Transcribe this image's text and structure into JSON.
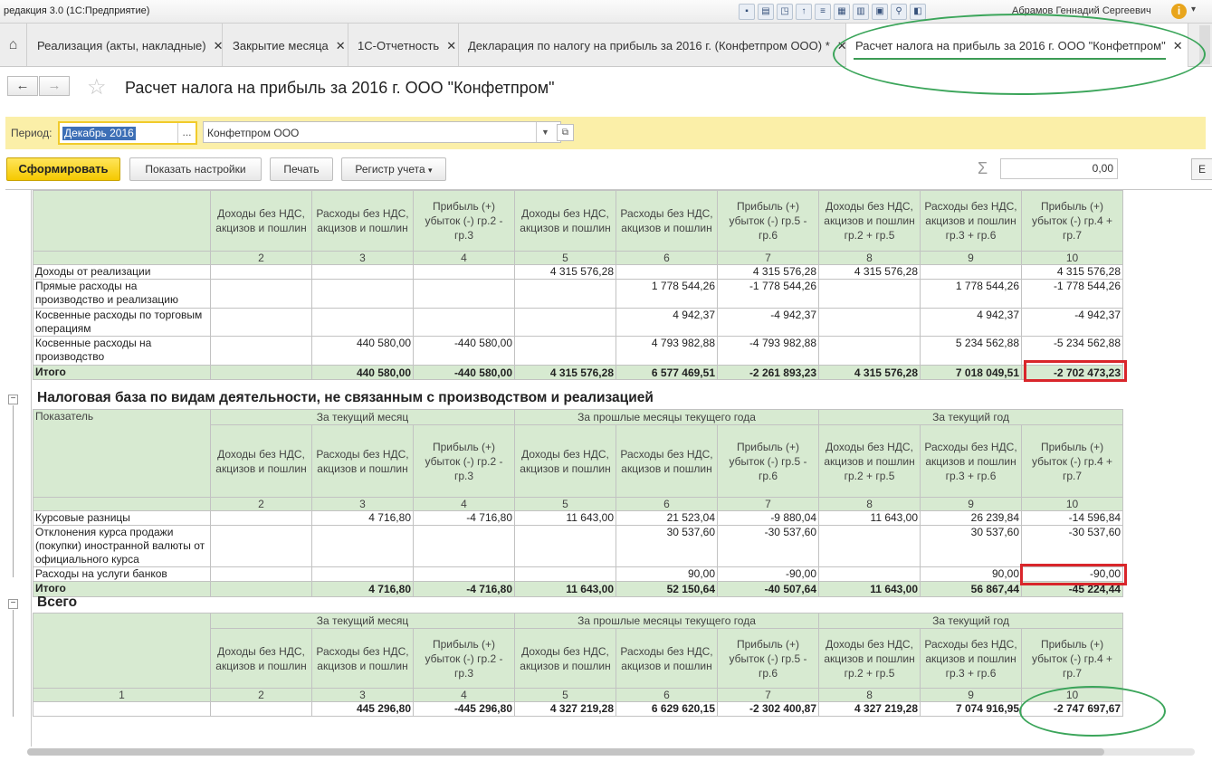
{
  "window": {
    "title": "редакция 3.0  (1С:Предприятие)",
    "user": "Абрамов Геннадий Сергеевич"
  },
  "tabs": [
    {
      "label": "Реализация (акты, накладные)"
    },
    {
      "label": "Закрытие месяца"
    },
    {
      "label": "1С-Отчетность"
    },
    {
      "label": "Декларация по налогу на прибыль за 2016 г. (Конфетпром ООО) *"
    },
    {
      "label": "Расчет налога на прибыль за 2016 г. ООО \"Конфетпром\""
    }
  ],
  "page": {
    "title": "Расчет налога на прибыль за 2016 г. ООО \"Конфетпром\""
  },
  "filters": {
    "period_label": "Период:",
    "period_value": "Декабрь 2016",
    "org_value": "Конфетпром ООО"
  },
  "toolbar": {
    "generate": "Сформировать",
    "show_settings": "Показать настройки",
    "print": "Печать",
    "registers": "Регистр учета",
    "sum_value": "0,00",
    "more": "Е"
  },
  "report": {
    "col_headers": {
      "income": "Доходы без НДС, акцизов и пошлин",
      "expense": "Расходы без НДС, акцизов и пошлин",
      "profit_cur": "Прибыль (+) убыток (-) гр.2 - гр.3",
      "income_prev": "Доходы без НДС, акцизов и пошлин",
      "expense_prev": "Расходы без НДС, акцизов и пошлин",
      "profit_prev": "Прибыль (+) убыток (-) гр.5 - гр.6",
      "income_year": "Доходы без НДС, акцизов и пошлин гр.2 + гр.5",
      "expense_year": "Расходы без НДС, акцизов и пошлин гр.3 + гр.6",
      "profit_year": "Прибыль (+) убыток (-) гр.4 + гр.7"
    },
    "period_headers": {
      "indicator": "Показатель",
      "current_month": "За текущий месяц",
      "prev_months": "За прошлые месяцы текущего года",
      "current_year": "За текущий год"
    },
    "col_numbers": [
      "1",
      "2",
      "3",
      "4",
      "5",
      "6",
      "7",
      "8",
      "9",
      "10"
    ],
    "section1": {
      "rows": [
        {
          "label": "Доходы от реализации",
          "v": [
            "",
            "",
            "",
            "4 315 576,28",
            "",
            "4 315 576,28",
            "4 315 576,28",
            "",
            "4 315 576,28"
          ]
        },
        {
          "label": "Прямые расходы на производство и реализацию",
          "v": [
            "",
            "",
            "",
            "",
            "1 778 544,26",
            "-1 778 544,26",
            "",
            "1 778 544,26",
            "-1 778 544,26"
          ]
        },
        {
          "label": "Косвенные расходы по торговым операциям",
          "v": [
            "",
            "",
            "",
            "",
            "4 942,37",
            "-4 942,37",
            "",
            "4 942,37",
            "-4 942,37"
          ]
        },
        {
          "label": "Косвенные расходы на производство",
          "v": [
            "",
            "440 580,00",
            "-440 580,00",
            "",
            "4 793 982,88",
            "-4 793 982,88",
            "",
            "5 234 562,88",
            "-5 234 562,88"
          ]
        }
      ],
      "total": {
        "label": "Итого",
        "v": [
          "",
          "440 580,00",
          "-440 580,00",
          "4 315 576,28",
          "6 577 469,51",
          "-2 261 893,23",
          "4 315 576,28",
          "7 018 049,51",
          "-2 702 473,23"
        ]
      }
    },
    "section2": {
      "title": "Налоговая база по видам деятельности, не связанным с производством и реализацией",
      "rows": [
        {
          "label": "Курсовые разницы",
          "v": [
            "",
            "4 716,80",
            "-4 716,80",
            "11 643,00",
            "21 523,04",
            "-9 880,04",
            "11 643,00",
            "26 239,84",
            "-14 596,84"
          ]
        },
        {
          "label": "Отклонения курса продажи (покупки) иностранной валюты от официального курса",
          "v": [
            "",
            "",
            "",
            "",
            "30 537,60",
            "-30 537,60",
            "",
            "30 537,60",
            "-30 537,60"
          ]
        },
        {
          "label": "Расходы на услуги банков",
          "v": [
            "",
            "",
            "",
            "",
            "90,00",
            "-90,00",
            "",
            "90,00",
            "-90,00"
          ]
        }
      ],
      "total": {
        "label": "Итого",
        "v": [
          "",
          "4 716,80",
          "-4 716,80",
          "11 643,00",
          "52 150,64",
          "-40 507,64",
          "11 643,00",
          "56 867,44",
          "-45 224,44"
        ]
      }
    },
    "section3": {
      "title": "Всего",
      "total": {
        "v": [
          "",
          "445 296,80",
          "-445 296,80",
          "4 327 219,28",
          "6 629 620,15",
          "-2 302 400,87",
          "4 327 219,28",
          "7 074 916,95",
          "-2 747 697,67"
        ]
      }
    }
  },
  "colors": {
    "header_bg": "#d7ead1",
    "highlight_red": "#d9262b",
    "annotation_green": "#3ba55a",
    "primary_button": "#f5c900"
  }
}
